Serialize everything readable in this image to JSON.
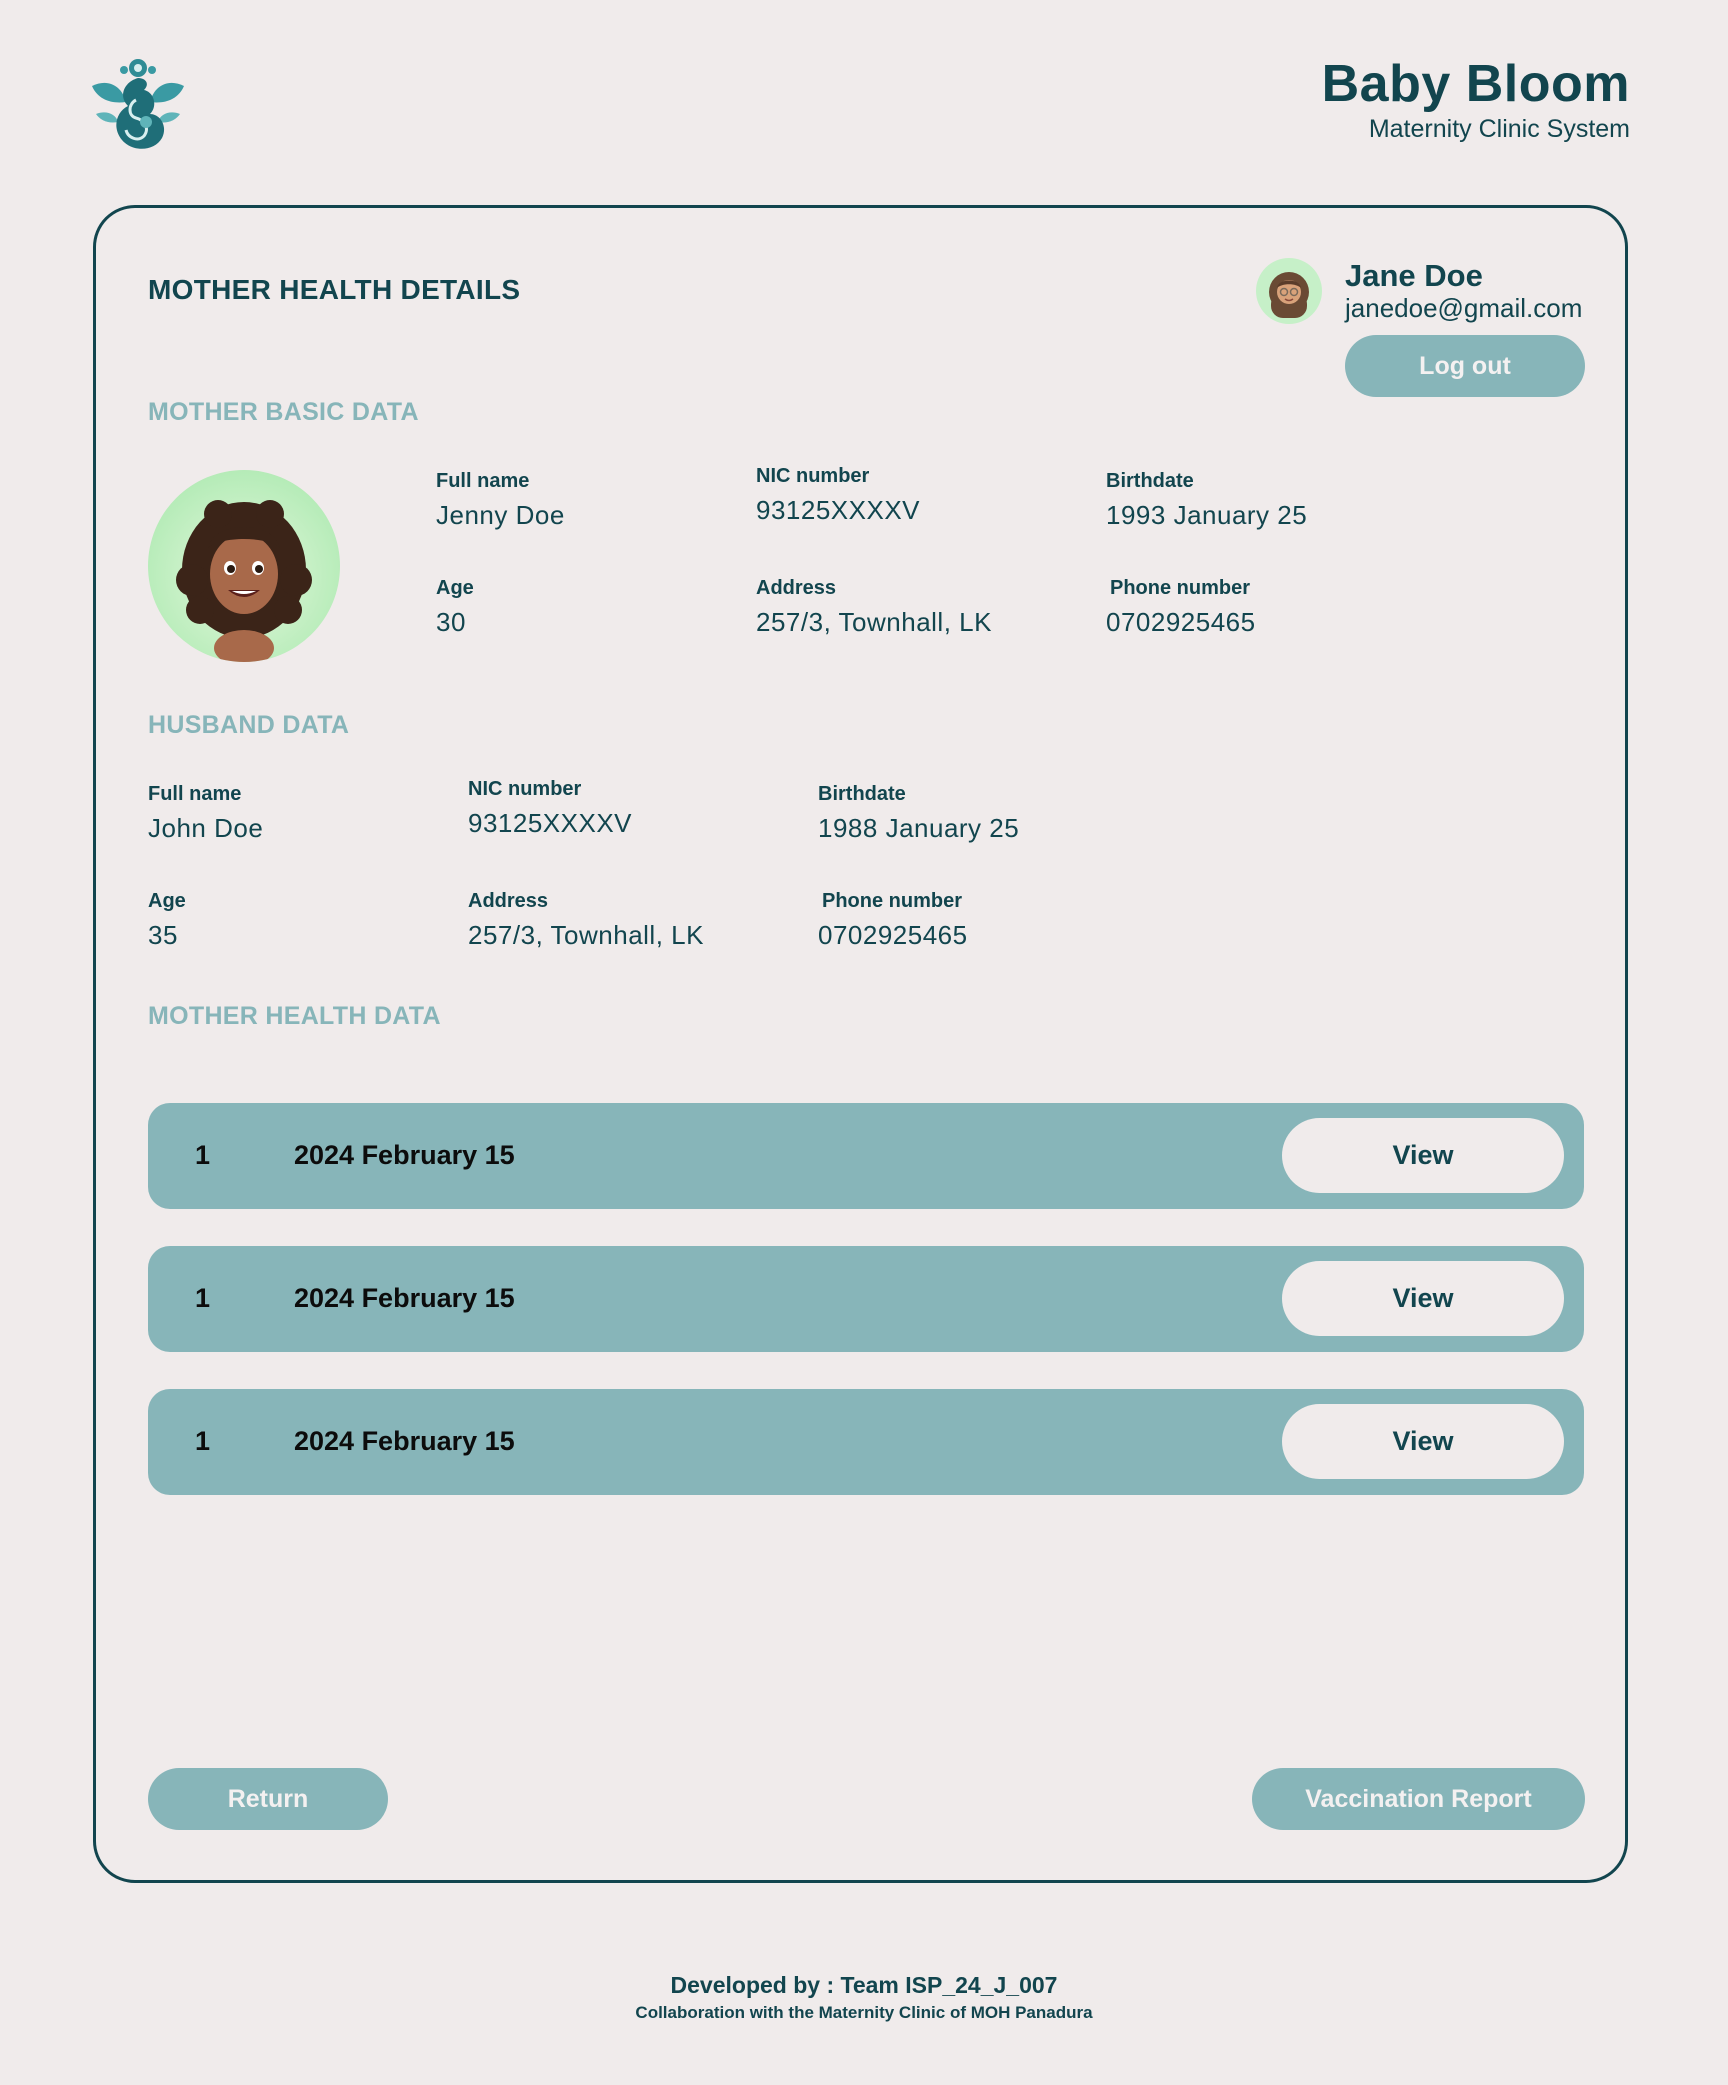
{
  "brand": {
    "title": "Baby Bloom",
    "subtitle": "Maternity Clinic System",
    "logo_icon": "mother-baby-lotus-logo"
  },
  "page": {
    "title": "MOTHER HEALTH DETAILS"
  },
  "user": {
    "name": "Jane Doe",
    "email": "janedoe@gmail.com",
    "logout_label": "Log out",
    "avatar_icon": "user-avatar"
  },
  "mother_basic": {
    "section_title": "MOTHER BASIC DATA",
    "avatar_icon": "mother-avatar",
    "full_name": {
      "label": "Full name",
      "value": "Jenny Doe"
    },
    "nic": {
      "label": "NIC number",
      "value": "93125XXXXV"
    },
    "birthdate": {
      "label": "Birthdate",
      "value": "1993 January 25"
    },
    "age": {
      "label": "Age",
      "value": "30"
    },
    "address": {
      "label": "Address",
      "value": "257/3, Townhall, LK"
    },
    "phone": {
      "label": "Phone number",
      "value": "0702925465"
    }
  },
  "husband": {
    "section_title": "HUSBAND DATA",
    "full_name": {
      "label": "Full name",
      "value": "John Doe"
    },
    "nic": {
      "label": "NIC number",
      "value": "93125XXXXV"
    },
    "birthdate": {
      "label": "Birthdate",
      "value": "1988 January 25"
    },
    "age": {
      "label": "Age",
      "value": "35"
    },
    "address": {
      "label": "Address",
      "value": "257/3, Townhall, LK"
    },
    "phone": {
      "label": "Phone number",
      "value": "0702925465"
    }
  },
  "health": {
    "section_title": "MOTHER HEALTH DATA",
    "records": [
      {
        "number": "1",
        "date": "2024 February 15",
        "action": "View"
      },
      {
        "number": "1",
        "date": "2024 February 15",
        "action": "View"
      },
      {
        "number": "1",
        "date": "2024 February 15",
        "action": "View"
      }
    ]
  },
  "actions": {
    "return_label": "Return",
    "vaccination_label": "Vaccination Report"
  },
  "footer": {
    "developed_by": "Developed by : Team ISP_24_J_007",
    "collaboration": "Collaboration with the Maternity Clinic of MOH Panadura"
  },
  "colors": {
    "primary": "#12454e",
    "accent": "#87b5b9",
    "background": "#f0ebeb",
    "avatar_bg": "#b7ecb9"
  }
}
